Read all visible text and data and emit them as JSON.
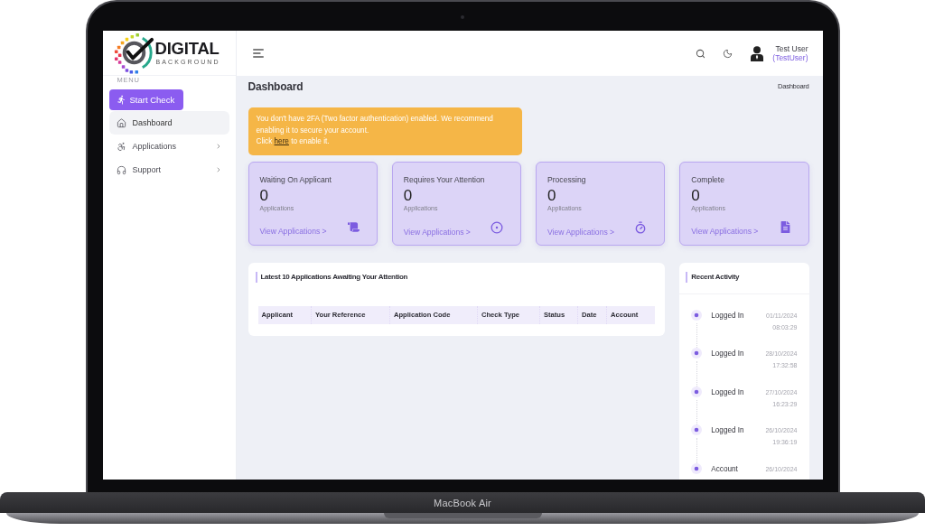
{
  "device": {
    "model_label": "MacBook Air"
  },
  "sidebar": {
    "logo": {
      "title": "DIGITAL",
      "subtitle": "BACKGROUND"
    },
    "menu_label": "MENU",
    "start_button": "Start Check",
    "items": [
      {
        "label": "Dashboard",
        "selected": true,
        "has_submenu": false
      },
      {
        "label": "Applications",
        "selected": false,
        "has_submenu": true
      },
      {
        "label": "Support",
        "selected": false,
        "has_submenu": true
      }
    ]
  },
  "topbar": {
    "user": {
      "name": "Test User",
      "username": "(TestUser)"
    }
  },
  "page_header": {
    "title": "Dashboard",
    "breadcrumb": "Dashboard"
  },
  "alert": {
    "message": "You don't have 2FA (Two factor authentication) enabled. We recommend enabling it to secure your account.",
    "action_prefix": "Click",
    "link": "here",
    "action_suffix": "to enable it."
  },
  "stat_cards": [
    {
      "title": "Waiting On Applicant",
      "count": "0",
      "unit": "Applications",
      "link": "View Applications >"
    },
    {
      "title": "Requires Your Attention",
      "count": "0",
      "unit": "Applications",
      "link": "View Applications >"
    },
    {
      "title": "Processing",
      "count": "0",
      "unit": "Applications",
      "link": "View Applications >"
    },
    {
      "title": "Complete",
      "count": "0",
      "unit": "Applications",
      "link": "View Applications >"
    }
  ],
  "applications_table": {
    "title": "Latest 10 Applications Awaiting Your Attention",
    "columns": [
      "Applicant",
      "Your Reference",
      "Application Code",
      "Check Type",
      "Status",
      "Date",
      "Account"
    ]
  },
  "recent_activity": {
    "title": "Recent Activity",
    "items": [
      {
        "text": "Logged In",
        "date": "01/11/2024",
        "time": "08:03:29"
      },
      {
        "text": "Logged In",
        "date": "28/10/2024",
        "time": "17:32:58"
      },
      {
        "text": "Logged In",
        "date": "27/10/2024",
        "time": "16:23:29"
      },
      {
        "text": "Logged In",
        "date": "26/10/2024",
        "time": "19:36:19"
      },
      {
        "text": "Account",
        "date": "26/10/2024"
      }
    ]
  }
}
